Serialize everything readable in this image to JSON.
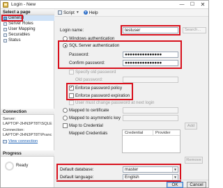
{
  "window": {
    "title": "Login - New"
  },
  "titlebar_controls": {
    "minimize": "—",
    "maximize": "☐",
    "close": "✕"
  },
  "left": {
    "select_page_header": "Select a page",
    "pages": [
      "General",
      "Server Roles",
      "User Mapping",
      "Securables",
      "Status"
    ],
    "selected_page": "General",
    "connection_header": "Connection",
    "server_label": "Server:",
    "server_value": "LAPTOP-2HN3PT8T\\SQLE",
    "connection_label": "Connection:",
    "connection_value": "LAPTOP-2HN3PT8T\\Pranc",
    "view_properties_link": "View connection",
    "progress_header": "Progress",
    "progress_status": "Ready"
  },
  "toolbar": {
    "script_label": "Script",
    "help_label": "Help"
  },
  "form": {
    "login_name_label": "Login name:",
    "login_name_value": "testuser",
    "search_button": "Search...",
    "windows_auth": "Windows authentication",
    "sql_auth": "SQL Server authentication",
    "password_label": "Password:",
    "password_value": "●●●●●●●●●●●●●●●",
    "confirm_label": "Confirm password:",
    "confirm_value": "●●●●●●●●●●●●●●●",
    "specify_old_password": "Specify old password",
    "old_password_label": "Old password:",
    "enforce_policy": "Enforce password policy",
    "enforce_expiration": "Enforce password expiration",
    "must_change": "User must change password at next login",
    "mapped_cert": "Mapped to certificate",
    "mapped_asym": "Mapped to asymmetric key",
    "map_credential": "Map to Credential",
    "mapped_credentials": "Mapped Credentials",
    "credential_col": "Credential",
    "provider_col": "Provider",
    "add_button": "Add",
    "remove_button": "Remove",
    "default_db_label": "Default database:",
    "default_db_value": "master",
    "default_lang_label": "Default language:",
    "default_lang_value": "English"
  },
  "footer": {
    "ok": "OK",
    "cancel": "Cancel"
  },
  "colors": {
    "highlight_box": "#d8101c",
    "selection": "#cfe2f7"
  }
}
